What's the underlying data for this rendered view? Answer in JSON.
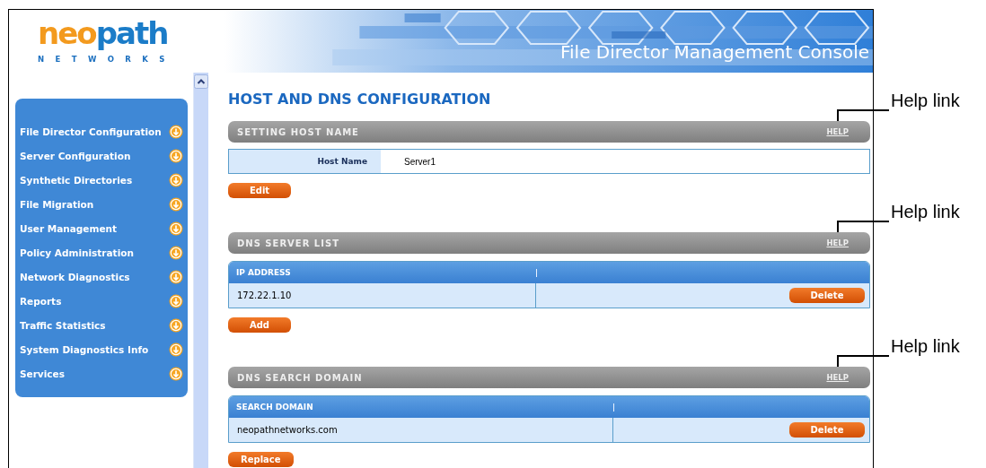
{
  "header": {
    "logo_primary": "neo",
    "logo_accent": "path",
    "logo_sub": "NETWORKS",
    "title": "File Director Management Console"
  },
  "sidebar": {
    "items": [
      {
        "label": "File Director Configuration"
      },
      {
        "label": "Server Configuration"
      },
      {
        "label": "Synthetic Directories"
      },
      {
        "label": "File Migration"
      },
      {
        "label": "User Management"
      },
      {
        "label": "Policy Administration"
      },
      {
        "label": "Network Diagnostics"
      },
      {
        "label": "Reports"
      },
      {
        "label": "Traffic Statistics"
      },
      {
        "label": "System Diagnostics Info"
      },
      {
        "label": "Services"
      }
    ]
  },
  "page_title": "HOST AND DNS CONFIGURATION",
  "sections": [
    {
      "title": "SETTING HOST NAME",
      "help": "HELP",
      "kind": "field",
      "field": {
        "label": "Host Name",
        "value": "Server1"
      },
      "button": "Edit",
      "annotation": "Help link"
    },
    {
      "title": "DNS SERVER LIST",
      "help": "HELP",
      "kind": "table",
      "column": "IP ADDRESS",
      "rows": [
        {
          "value": "172.22.1.10",
          "action": "Delete"
        }
      ],
      "button": "Add",
      "annotation": "Help link"
    },
    {
      "title": "DNS SEARCH DOMAIN",
      "help": "HELP",
      "kind": "table",
      "column": "SEARCH DOMAIN",
      "rows": [
        {
          "value": "neopathnetworks.com",
          "action": "Delete"
        }
      ],
      "button": "Replace",
      "annotation": "Help link"
    }
  ]
}
